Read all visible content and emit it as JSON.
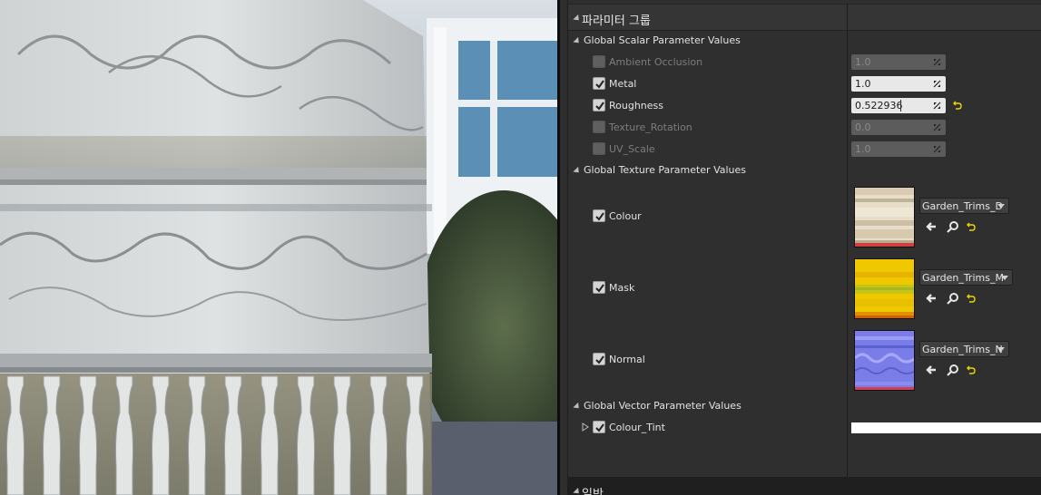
{
  "viewport": {
    "name": "material-preview-viewport"
  },
  "panel": {
    "group_title": "파라미터 그룹",
    "scalar_section": {
      "title": "Global Scalar Parameter Values",
      "params": [
        {
          "label": "Ambient Occlusion",
          "value": "1.0",
          "enabled": false
        },
        {
          "label": "Metal",
          "value": "1.0",
          "enabled": true
        },
        {
          "label": "Roughness",
          "value": "0.522936",
          "enabled": true,
          "modified": true
        },
        {
          "label": "Texture_Rotation",
          "value": "0.0",
          "enabled": false
        },
        {
          "label": "UV_Scale",
          "value": "1.0",
          "enabled": false
        }
      ]
    },
    "texture_section": {
      "title": "Global Texture Parameter Values",
      "params": [
        {
          "label": "Colour",
          "texture": "Garden_Trims_D",
          "enabled": true
        },
        {
          "label": "Mask",
          "texture": "Garden_Trims_M",
          "enabled": true
        },
        {
          "label": "Normal",
          "texture": "Garden_Trims_N",
          "enabled": true
        }
      ]
    },
    "vector_section": {
      "title": "Global Vector Parameter Values",
      "params": [
        {
          "label": "Colour_Tint",
          "color": "#ffffff",
          "enabled": true
        }
      ]
    },
    "general_title": "일반"
  },
  "icons": {
    "browse": "left-arrow-icon",
    "find": "magnifier-icon",
    "reset": "reset-to-default-icon",
    "expand": "expand-triangle-icon"
  },
  "colors": {
    "panel_bg": "#2f2f2f",
    "reset_yellow": "#e8d800",
    "mask_yellow": "#f0c800",
    "normal_blue": "#7a7de8"
  }
}
